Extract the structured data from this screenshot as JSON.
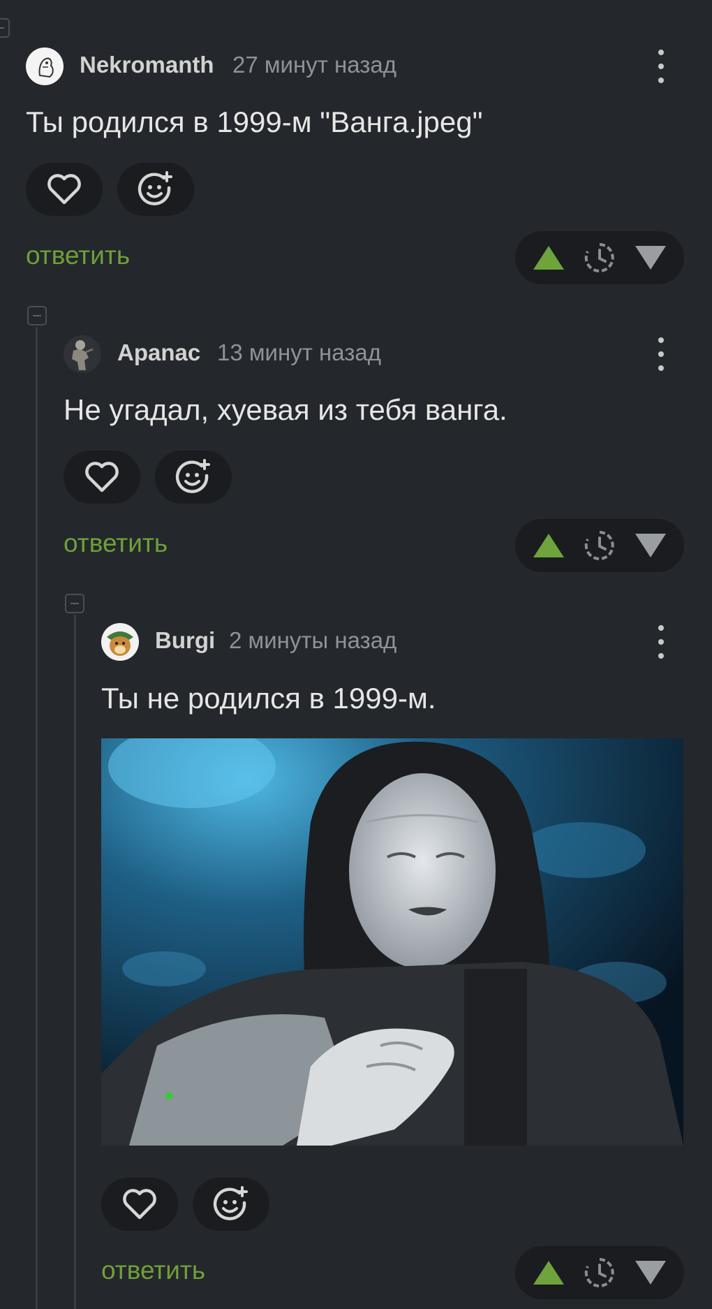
{
  "comments": [
    {
      "author": "Nekromanth",
      "time": "27 минут назад",
      "text": "Ты родился в 1999-м \"Ванга.jpeg\"",
      "reply_label": "ответить"
    },
    {
      "author": "Apanac",
      "time": "13 минут назад",
      "text": "Не угадал, хуевая из тебя ванга.",
      "reply_label": "ответить"
    },
    {
      "author": "Burgi",
      "time": "2 минуты назад",
      "text": "Ты не родился в 1999-м.",
      "reply_label": "ответить"
    }
  ],
  "icons": {
    "like": "heart-icon",
    "reaction": "add-emoji-icon",
    "upvote": "arrow-up-triangle-icon",
    "rating": "pending-clock-icon",
    "downvote": "arrow-down-triangle-icon",
    "menu": "more-vertical-icon",
    "collapse": "collapse-minus-icon"
  },
  "colors": {
    "background": "#24272b",
    "pill": "#1a1c1f",
    "accent_green": "#6fa03a",
    "upvote": "#6fa33b",
    "muted": "#8f9399"
  }
}
